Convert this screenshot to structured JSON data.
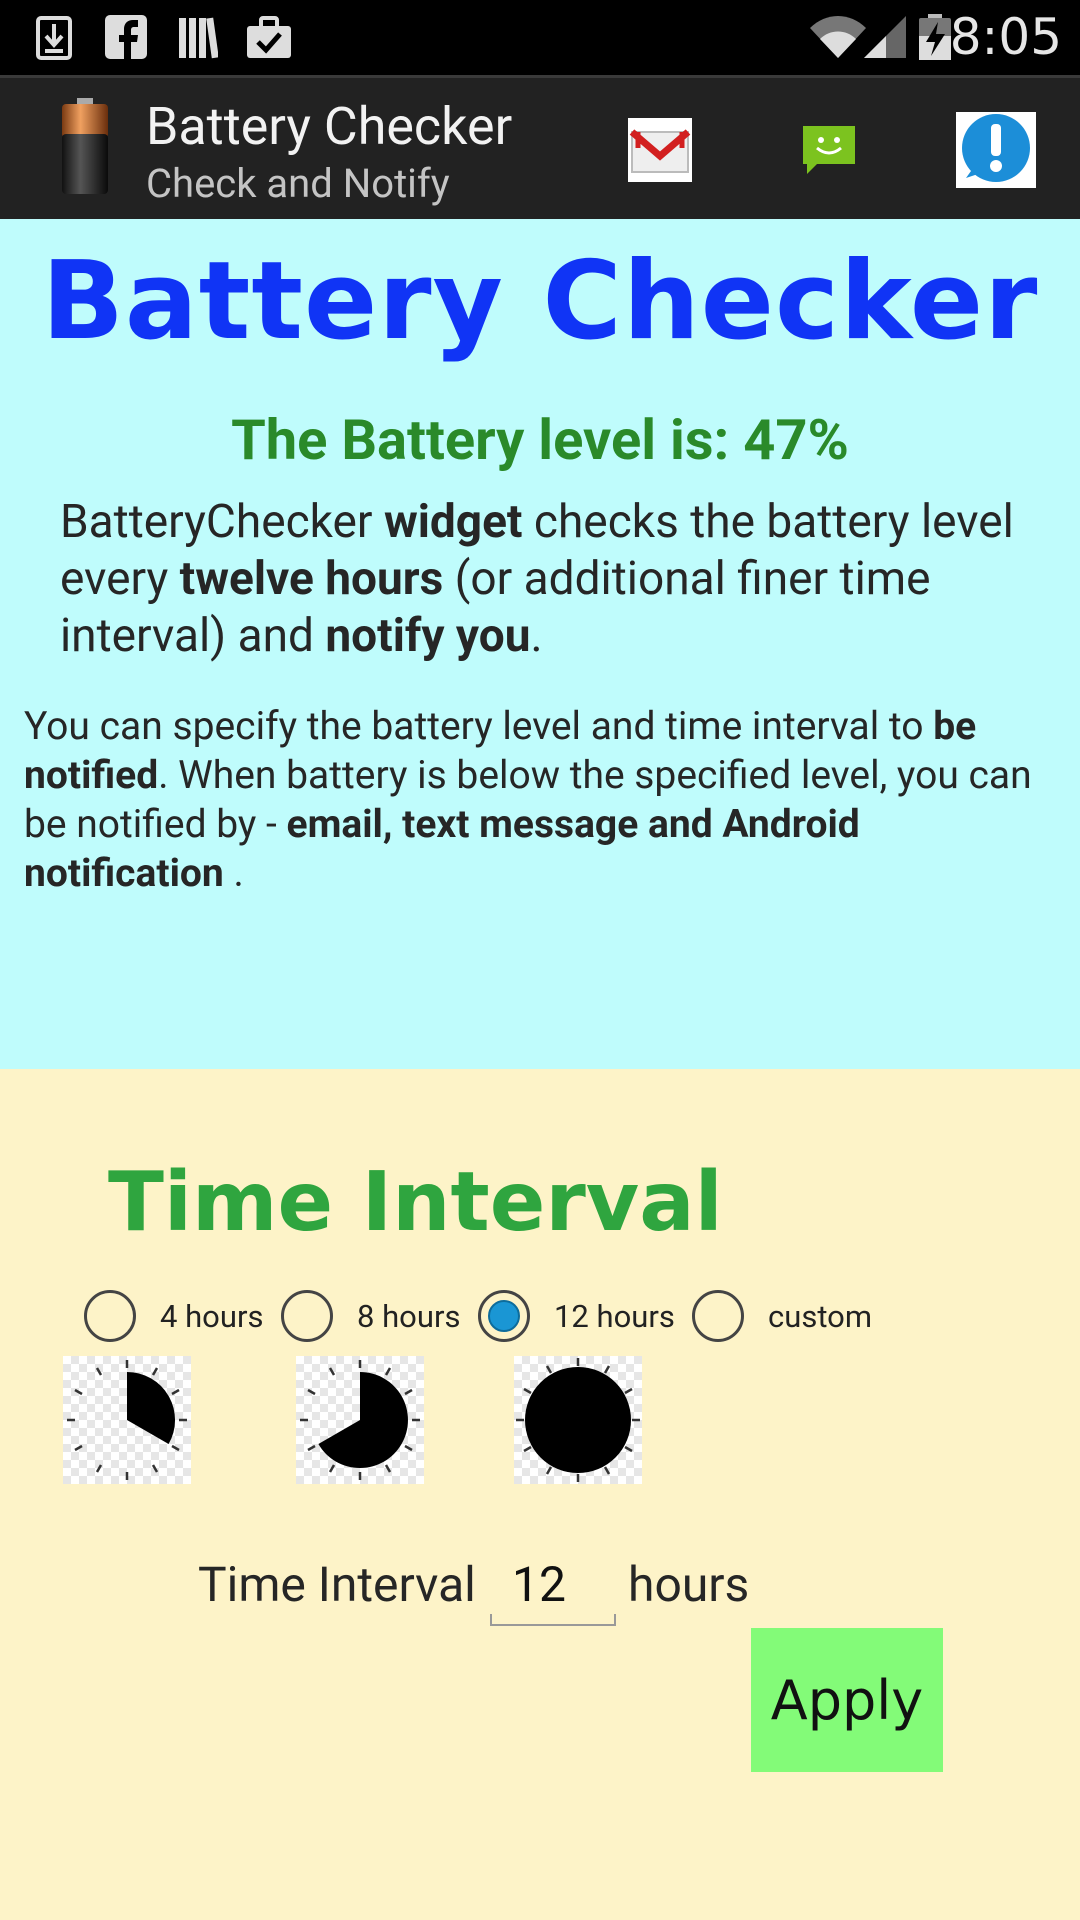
{
  "status_bar": {
    "time": "8:05",
    "icons": [
      "download-icon",
      "facebook-icon",
      "library-icon",
      "briefcase-check-icon",
      "wifi-icon",
      "signal-icon",
      "battery-icon"
    ]
  },
  "action_bar": {
    "title": "Battery Checker",
    "subtitle": "Check and Notify",
    "actions": [
      "gmail-icon",
      "sms-icon",
      "info-icon"
    ]
  },
  "info": {
    "title": "Battery Checker",
    "battery_level": "The Battery level is: 47%",
    "para1": {
      "t1": "BatteryChecker ",
      "b1": "widget",
      "t2": " checks the battery level every  ",
      "b2": "twelve hours",
      "t3": " (or additional finer time interval) and ",
      "b3": "notify you",
      "t4": "."
    },
    "para2": {
      "t1": " You can specify the battery level and time interval to ",
      "b1": "be notified",
      "t2": ". When battery is below the specified level, you can be notified by - ",
      "b2": "email, text message and Android notification",
      "t3": " ."
    }
  },
  "interval": {
    "heading": "Time Interval",
    "options": [
      {
        "label": "4 hours",
        "checked": false
      },
      {
        "label": "8 hours",
        "checked": false
      },
      {
        "label": "12 hours",
        "checked": true
      },
      {
        "label": "custom",
        "checked": false
      }
    ],
    "field_label": "Time Interval",
    "field_value": "12",
    "field_unit": "hours",
    "apply_label": "Apply"
  },
  "colors": {
    "title_blue": "#1034f5",
    "level_green": "#2a8a2a",
    "interval_green": "#2fa53f",
    "info_bg": "#bffcfc",
    "bottom_bg": "#fdf3c8",
    "apply_bg": "#83fb78",
    "radio_checked": "#1a96d4"
  }
}
